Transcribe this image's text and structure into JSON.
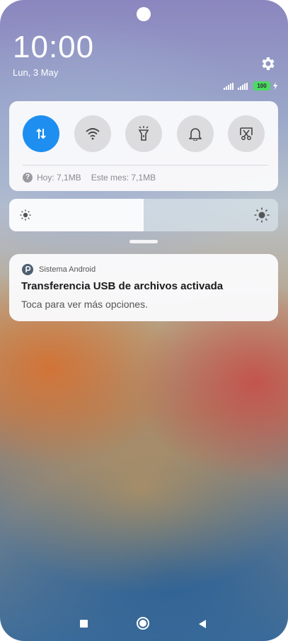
{
  "status": {
    "time": "10:00",
    "date": "Lun, 3 May",
    "battery": "100"
  },
  "quick_settings": {
    "toggles": [
      {
        "name": "mobile-data",
        "icon": "data-transfer-icon",
        "active": true
      },
      {
        "name": "wifi",
        "icon": "wifi-icon",
        "active": false
      },
      {
        "name": "flashlight",
        "icon": "flashlight-icon",
        "active": false
      },
      {
        "name": "sound",
        "icon": "bell-icon",
        "active": false
      },
      {
        "name": "screenshot",
        "icon": "scissors-screenshot-icon",
        "active": false
      }
    ],
    "usage_today": "Hoy: 7,1MB",
    "usage_month": "Este mes: 7,1MB",
    "accent_color": "#1e8ff0"
  },
  "brightness": {
    "level": 0.5
  },
  "notification": {
    "app_name": "Sistema Android",
    "title": "Transferencia USB de archivos activada",
    "body": "Toca para ver más opciones."
  }
}
